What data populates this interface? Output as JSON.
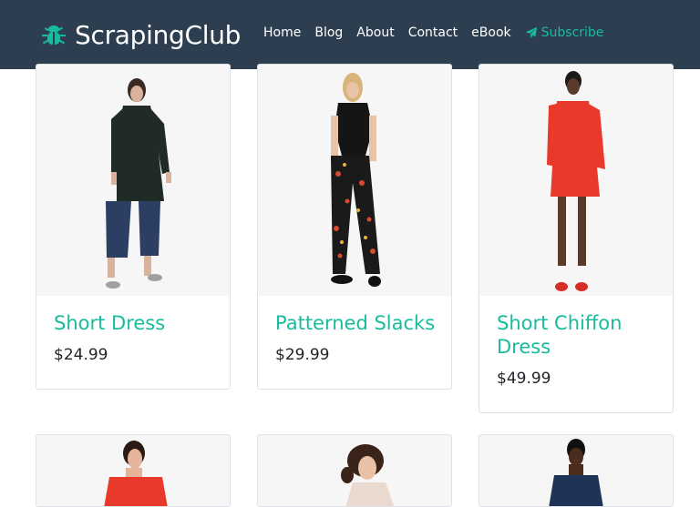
{
  "brand": {
    "name": "ScrapingClub",
    "icon": "bug-icon"
  },
  "nav": {
    "items": [
      "Home",
      "Blog",
      "About",
      "Contact",
      "eBook"
    ],
    "subscribe": {
      "label": "Subscribe",
      "icon": "paper-plane-icon"
    }
  },
  "colors": {
    "navbar": "#2c3e50",
    "accent": "#18bc9c"
  },
  "products": [
    {
      "title": "Short Dress",
      "price": "$24.99"
    },
    {
      "title": "Patterned Slacks",
      "price": "$29.99"
    },
    {
      "title": "Short Chiffon Dress",
      "price": "$49.99"
    },
    {
      "title": "",
      "price": ""
    },
    {
      "title": "",
      "price": ""
    },
    {
      "title": "",
      "price": ""
    }
  ]
}
